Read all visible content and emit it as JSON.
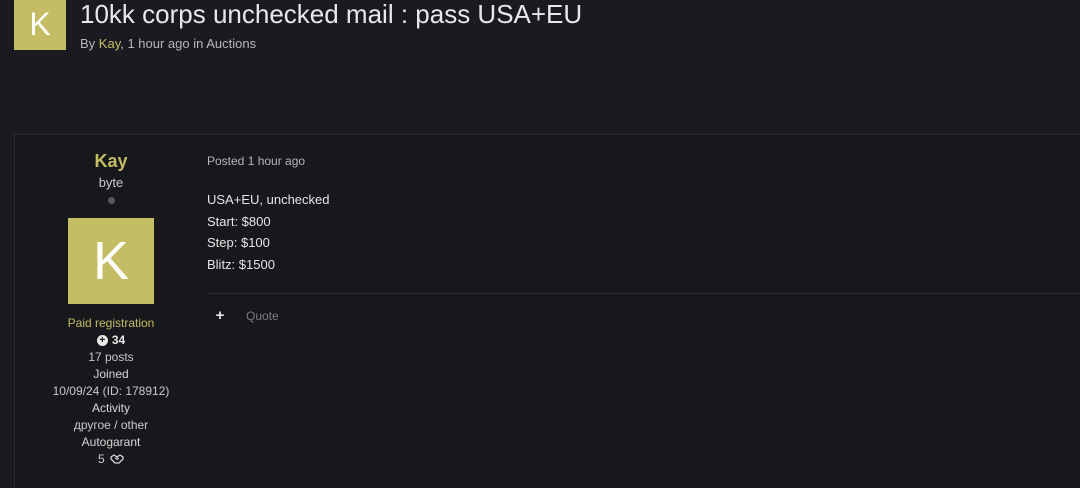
{
  "topic": {
    "avatar_letter": "K",
    "title": "10kk corps unchecked mail : pass USA+EU",
    "byline_prefix": "By",
    "author": "Kay",
    "byline_rest": ", 1 hour ago in Auctions"
  },
  "author_panel": {
    "name": "Kay",
    "rank": "byte",
    "avatar_letter": "K",
    "group": "Paid registration",
    "reputation": "34",
    "posts": "17 posts",
    "joined_label": "Joined",
    "joined_value": "10/09/24 (ID: 178912)",
    "activity_label": "Activity",
    "activity_value": "другое / other",
    "autogarant_label": "Autogarant",
    "autogarant_value": "5"
  },
  "post": {
    "posted": "Posted 1 hour ago",
    "lines": [
      "USA+EU, unchecked",
      "Start: $800",
      "Step: $100",
      "Blitz: $1500"
    ],
    "actions": {
      "plus": "+",
      "quote": "Quote"
    }
  },
  "colors": {
    "accent": "#c5bd63",
    "background": "#1a1b20"
  }
}
